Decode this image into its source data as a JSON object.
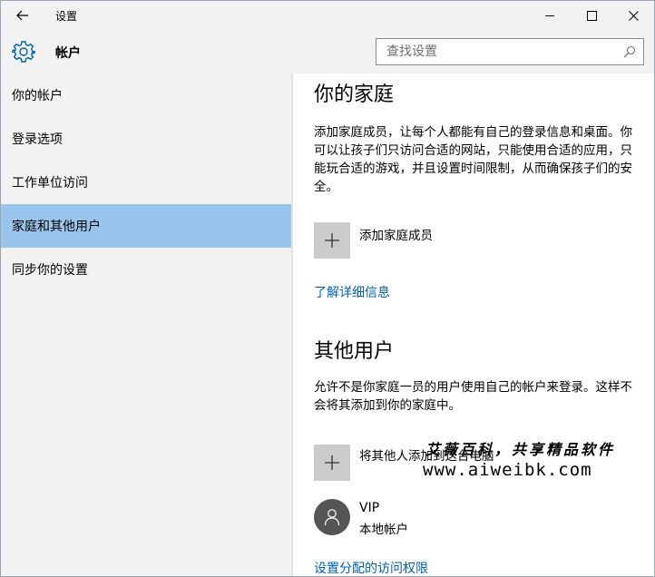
{
  "titlebar": {
    "title": "设置",
    "back_icon": "arrow-left-icon",
    "minimize_icon": "minimize-icon",
    "maximize_icon": "maximize-icon",
    "close_icon": "close-icon"
  },
  "header": {
    "icon": "gear-icon",
    "title": "帐户",
    "accent_color": "#0063b1"
  },
  "search": {
    "placeholder": "查找设置",
    "icon": "search-icon"
  },
  "sidebar": {
    "items": [
      {
        "label": "你的帐户",
        "active": false
      },
      {
        "label": "登录选项",
        "active": false
      },
      {
        "label": "工作单位访问",
        "active": false
      },
      {
        "label": "家庭和其他用户",
        "active": true
      },
      {
        "label": "同步你的设置",
        "active": false
      }
    ],
    "active_color": "#99c5ed"
  },
  "family": {
    "heading": "你的家庭",
    "description": "添加家庭成员，让每个人都能有自己的登录信息和桌面。你可以让孩子们只访问合适的网站，只能使用合适的应用，只能玩合适的游戏，并且设置时间限制，从而确保孩子们的安全。",
    "add_label": "添加家庭成员",
    "learn_more": "了解详细信息"
  },
  "others": {
    "heading": "其他用户",
    "description": "允许不是你家庭一员的用户使用自己的帐户来登录。这样不会将其添加到你的家庭中。",
    "add_label": "将其他人添加到这台电脑",
    "user": {
      "name": "VIP",
      "type": "本地帐户",
      "icon": "person-icon"
    },
    "assigned_access": "设置分配的访问权限"
  },
  "watermark": {
    "line1": "艾薇百科，共享精品软件",
    "line2": "www.aiweibk.com"
  },
  "colors": {
    "link": "#0063b1",
    "tile": "#cccccc",
    "avatar": "#555555",
    "sidebar_bg": "#f2f2f2"
  }
}
